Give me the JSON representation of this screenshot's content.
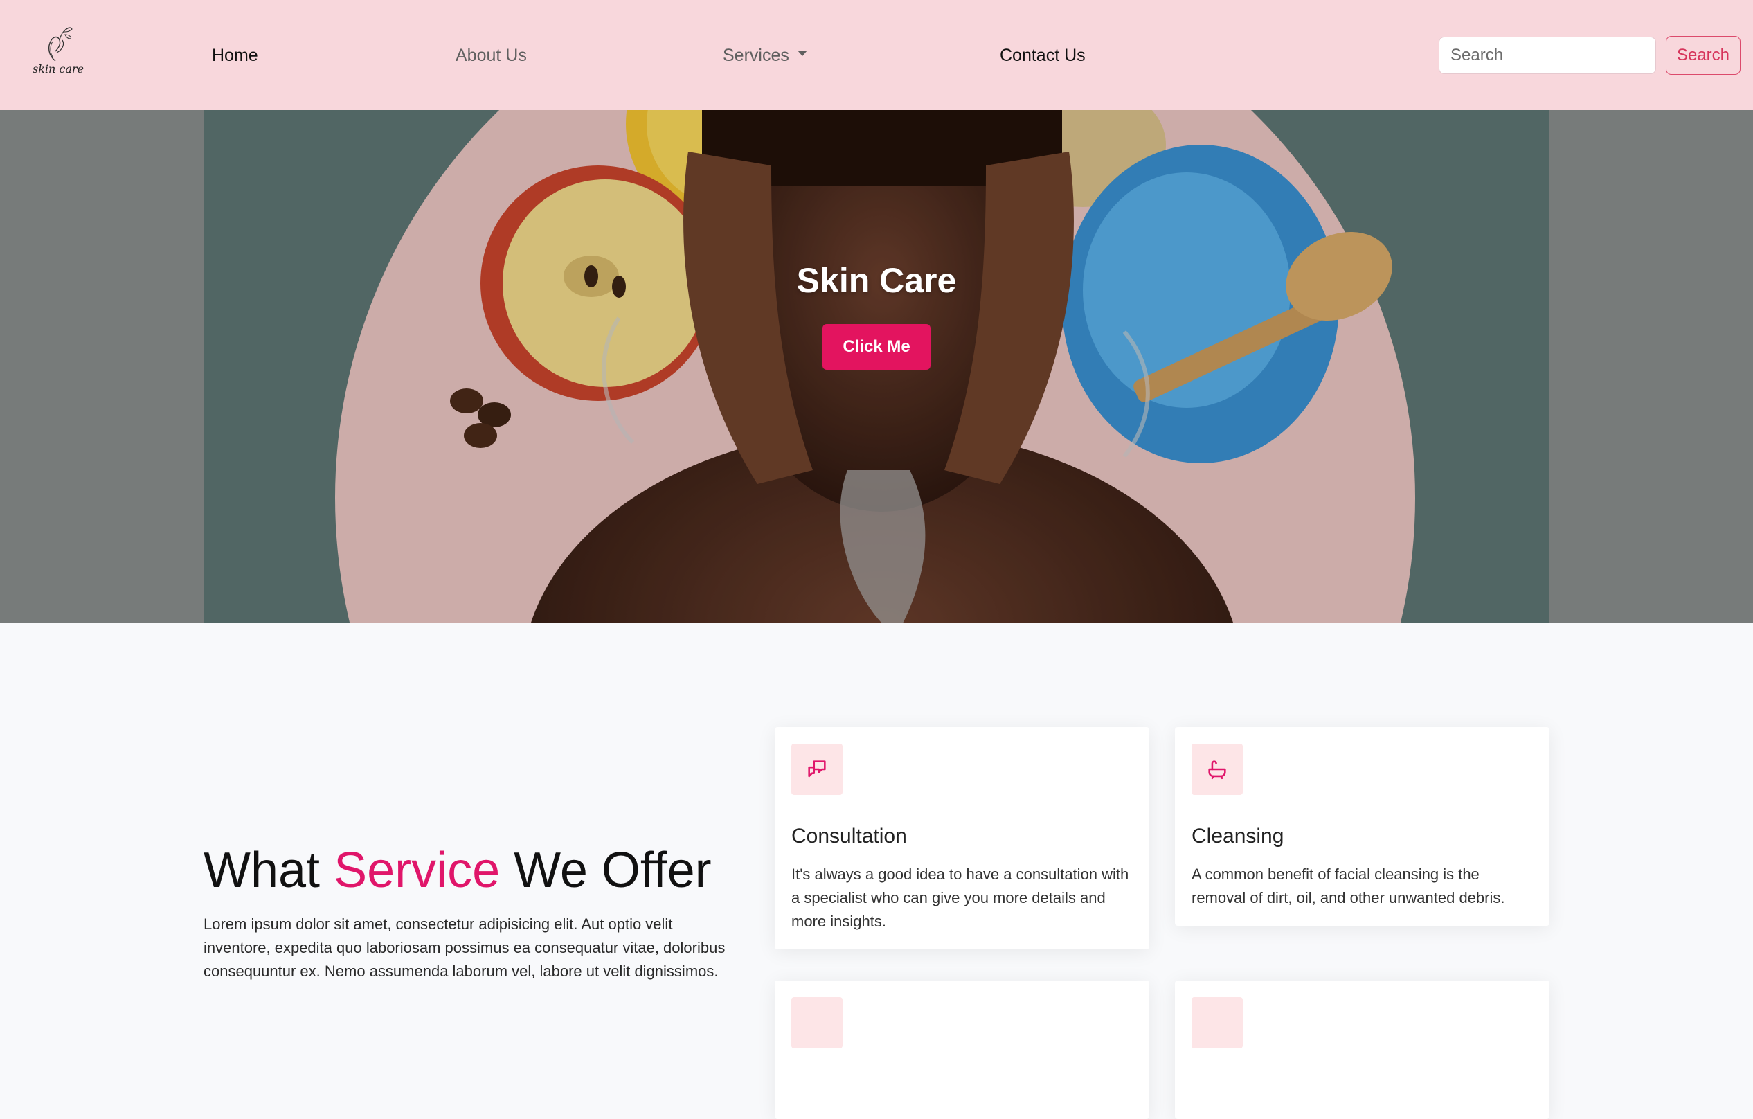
{
  "brand": {
    "logo_text": "skin care"
  },
  "nav": {
    "home": "Home",
    "about": "About Us",
    "services": "Services",
    "contact": "Contact Us"
  },
  "search": {
    "placeholder": "Search",
    "button": "Search"
  },
  "hero": {
    "title": "Skin Care",
    "button": "Click Me"
  },
  "services_section": {
    "title_part1": "What ",
    "title_accent": "Service",
    "title_part2": " We Offer",
    "description": "Lorem ipsum dolor sit amet, consectetur adipisicing elit. Aut optio velit inventore, expedita quo laboriosam possimus ea consequatur vitae, doloribus consequuntur ex. Nemo assumenda laborum vel, labore ut velit dignissimos.",
    "cards": [
      {
        "icon": "chat-bubbles-icon",
        "title": "Consultation",
        "text": "It's always a good idea to have a consultation with a specialist who can give you more details and more insights."
      },
      {
        "icon": "bathtub-icon",
        "title": "Cleansing",
        "text": "A common benefit of facial cleansing is the removal of dirt, oil, and other unwanted debris."
      },
      {
        "icon": "service-icon",
        "title": "",
        "text": ""
      },
      {
        "icon": "service-icon",
        "title": "",
        "text": ""
      }
    ]
  },
  "colors": {
    "navbar_bg": "#f8d7dc",
    "accent": "#e0166a",
    "button": "#e3145f",
    "icon_bg": "#fde5e7",
    "page_bg": "#f8f9fb"
  }
}
